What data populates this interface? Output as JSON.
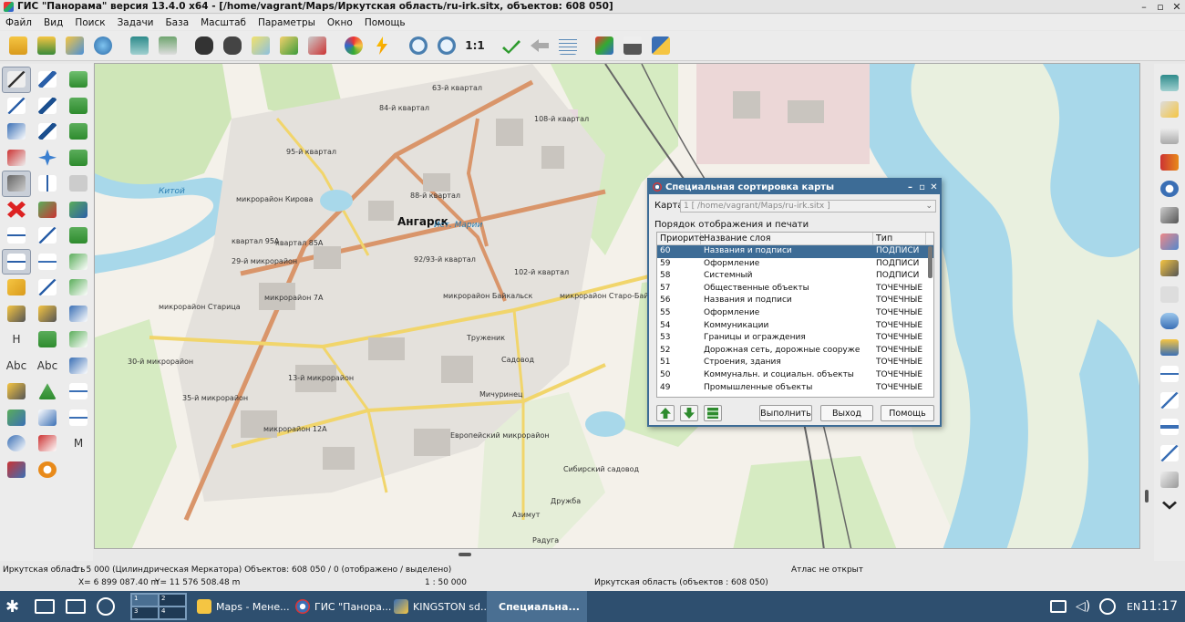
{
  "window": {
    "title": "ГИС \"Панорама\" версия 13.4.0 x64 - [/home/vagrant/Maps/Иркутская область/ru-irk.sitx, объектов: 608 050]",
    "controls": [
      "–",
      "▫",
      "✕"
    ]
  },
  "menu": [
    "Файл",
    "Вид",
    "Поиск",
    "Задачи",
    "База",
    "Масштаб",
    "Параметры",
    "Окно",
    "Помощь"
  ],
  "toolbar": {
    "scale_11": "1:1",
    "icons": [
      "open-folder-icon",
      "open-folder-plus-icon",
      "folders-icon",
      "globe-icon",
      "layers-icon",
      "save-icon",
      "binoculars-icon",
      "binoculars-next-icon",
      "brush-icon",
      "add-object-icon",
      "delete-object-icon",
      "palette-icon",
      "lightning-icon",
      "zoom-in-icon",
      "zoom-out-icon",
      "zoom-1to1-icon",
      "apply-icon",
      "back-icon",
      "legend-icon",
      "paint-icon",
      "print-icon",
      "help-pointer-icon"
    ]
  },
  "left_palette": {
    "text_tools": [
      "H",
      "Abc",
      "Abc",
      "M"
    ]
  },
  "map": {
    "labels": [
      {
        "text": "Ангарск",
        "kind": "big"
      },
      {
        "text": "Китой",
        "kind": "river"
      },
      {
        "text": "Ист. Марии",
        "kind": "river"
      },
      {
        "text": "95-й квартал",
        "kind": "normal"
      },
      {
        "text": "микрорайон Кирова",
        "kind": "normal"
      },
      {
        "text": "квартал 95А",
        "kind": "normal"
      },
      {
        "text": "квартал 85А",
        "kind": "normal"
      },
      {
        "text": "88-й квартал",
        "kind": "normal"
      },
      {
        "text": "29-й микрорайон",
        "kind": "normal"
      },
      {
        "text": "92/93-й квартал",
        "kind": "normal"
      },
      {
        "text": "102-й квартал",
        "kind": "normal"
      },
      {
        "text": "микрорайон Старица",
        "kind": "normal"
      },
      {
        "text": "микрорайон 7А",
        "kind": "normal"
      },
      {
        "text": "микрорайон Байкальск",
        "kind": "normal"
      },
      {
        "text": "микрорайон Старо-Байкальск",
        "kind": "normal"
      },
      {
        "text": "Труженик",
        "kind": "normal"
      },
      {
        "text": "Садовод",
        "kind": "normal"
      },
      {
        "text": "30-й микрорайон",
        "kind": "normal"
      },
      {
        "text": "13-й микрорайон",
        "kind": "normal"
      },
      {
        "text": "35-й микрорайон",
        "kind": "normal"
      },
      {
        "text": "Мичуринец",
        "kind": "normal"
      },
      {
        "text": "микрорайон 12А",
        "kind": "normal"
      },
      {
        "text": "Европейский микрорайон",
        "kind": "normal"
      },
      {
        "text": "Сибирский садовод",
        "kind": "normal"
      },
      {
        "text": "Дружба",
        "kind": "normal"
      },
      {
        "text": "Азимут",
        "kind": "normal"
      },
      {
        "text": "Радуга",
        "kind": "normal"
      },
      {
        "text": "108-й квартал",
        "kind": "normal"
      },
      {
        "text": "63-й квартал",
        "kind": "normal"
      },
      {
        "text": "84-й квартал",
        "kind": "normal"
      }
    ]
  },
  "dialog": {
    "title": "Специальная сортировка карты",
    "map_label": "Карта",
    "map_value": "1 [ /home/vagrant/Maps/ru-irk.sitx ]",
    "group_label": "Порядок отображения и печати",
    "columns": [
      "Приорите",
      "Название слоя",
      "Тип"
    ],
    "rows": [
      {
        "priority": "60",
        "name": "Названия и подписи",
        "type": "ПОДПИСИ",
        "selected": true
      },
      {
        "priority": "59",
        "name": "Оформление",
        "type": "ПОДПИСИ",
        "selected": false
      },
      {
        "priority": "58",
        "name": "Системный",
        "type": "ПОДПИСИ",
        "selected": false
      },
      {
        "priority": "57",
        "name": "Общественные объекты",
        "type": "ТОЧЕЧНЫЕ",
        "selected": false
      },
      {
        "priority": "56",
        "name": "Названия и подписи",
        "type": "ТОЧЕЧНЫЕ",
        "selected": false
      },
      {
        "priority": "55",
        "name": "Оформление",
        "type": "ТОЧЕЧНЫЕ",
        "selected": false
      },
      {
        "priority": "54",
        "name": "Коммуникации",
        "type": "ТОЧЕЧНЫЕ",
        "selected": false
      },
      {
        "priority": "53",
        "name": "Границы и ограждения",
        "type": "ТОЧЕЧНЫЕ",
        "selected": false
      },
      {
        "priority": "52",
        "name": "Дорожная сеть, дорожные сооруже",
        "type": "ТОЧЕЧНЫЕ",
        "selected": false
      },
      {
        "priority": "51",
        "name": "Строения, здания",
        "type": "ТОЧЕЧНЫЕ",
        "selected": false
      },
      {
        "priority": "50",
        "name": "Коммунальн. и социальн. объекты",
        "type": "ТОЧЕЧНЫЕ",
        "selected": false
      },
      {
        "priority": "49",
        "name": "Промышленные объекты",
        "type": "ТОЧЕЧНЫЕ",
        "selected": false
      }
    ],
    "buttons": {
      "execute": "Выполнить",
      "exit": "Выход",
      "help": "Помощь"
    }
  },
  "status": {
    "region": "Иркутская область",
    "scale_info": "1 : 5 000 (Цилиндрическая Меркатора) Объектов: 608 050 / 0 (отображено / выделено)",
    "atlas": "Атлас не открыт",
    "x": "X= 6 899 087.40 m",
    "y": "Y= 11 576 508.48 m",
    "scale": "1 : 50 000",
    "region2": "Иркутская область  (объектов : 608 050)"
  },
  "taskbar": {
    "pager": [
      "1",
      "2",
      "3",
      "4"
    ],
    "tasks": [
      {
        "label": "Maps - Мене...",
        "active": false
      },
      {
        "label": "ГИС \"Панора...",
        "active": false
      },
      {
        "label": "KINGSTON sd...",
        "active": false
      },
      {
        "label": "Специальна...",
        "active": true
      }
    ],
    "lang": "EN",
    "clock": "11:17"
  },
  "colors": {
    "accent": "#3d6c96",
    "taskbar": "#2e4f6f",
    "water": "#a8d8ea",
    "forest": "#cfe6b8",
    "road_main": "#d9956a",
    "road_yellow": "#f1d56b"
  }
}
